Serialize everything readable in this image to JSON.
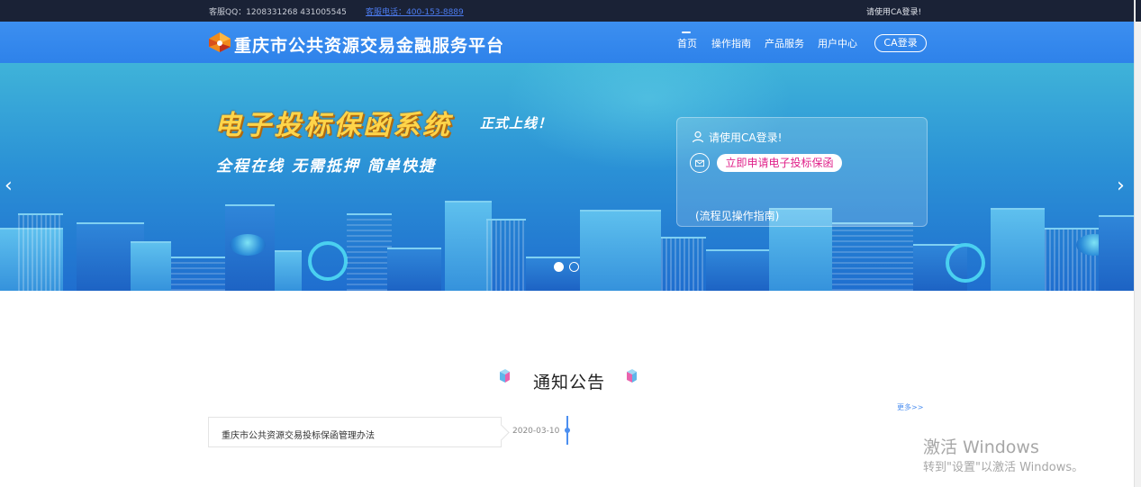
{
  "topbar": {
    "qq_text": "客服QQ：1208331268   431005545",
    "phone_text": "客服电话：400-153-8889",
    "login_hint": "请使用CA登录!"
  },
  "header": {
    "site_title": "重庆市公共资源交易金融服务平台",
    "nav": {
      "home": "首页",
      "guide": "操作指南",
      "product": "产品服务",
      "user": "用户中心"
    },
    "ca_login": "CA登录"
  },
  "banner": {
    "headline": "电子投标保函系统",
    "headline_sub": "正式上线！",
    "slogan": "全程在线  无需抵押  简单快捷",
    "prev_arrow": "‹",
    "next_arrow": "›",
    "slides_total": 2,
    "slide_active": 1,
    "card": {
      "login_text": "请使用CA登录!",
      "apply_button": "立即申请电子投标保函",
      "flow_text": "(流程见操作指南)"
    }
  },
  "notices": {
    "title": "通知公告",
    "more": "更多>>",
    "items": [
      {
        "title": "重庆市公共资源交易投标保函管理办法",
        "date": "2020-03-10"
      }
    ]
  },
  "watermark": {
    "title": "激活 Windows",
    "subtitle": "转到\"设置\"以激活 Windows。"
  },
  "colors": {
    "topbar_bg": "#1a2236",
    "header_blue": "#3c8ff0",
    "accent_pink": "#e0218a",
    "headline_yellow": "#ffd54a",
    "link_blue": "#4c8ff0"
  },
  "icons": {
    "logo": "platform-logo",
    "user": "user-icon",
    "mail": "mail-icon"
  }
}
